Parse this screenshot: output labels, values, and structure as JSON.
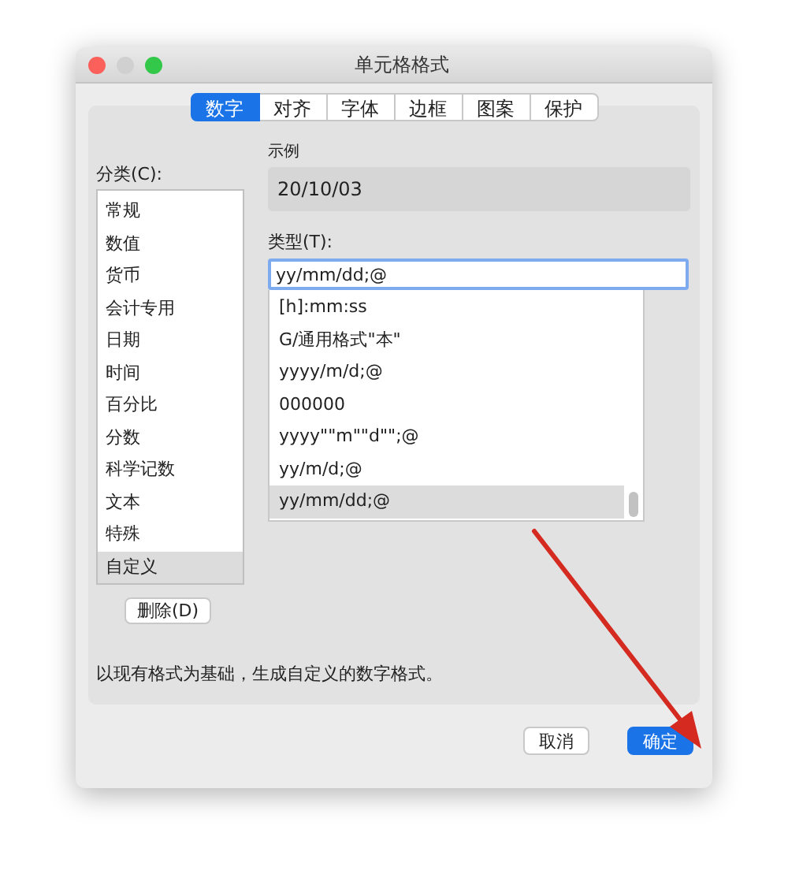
{
  "window": {
    "title": "单元格格式"
  },
  "tabs": [
    {
      "label": "数字",
      "selected": true
    },
    {
      "label": "对齐",
      "selected": false
    },
    {
      "label": "字体",
      "selected": false
    },
    {
      "label": "边框",
      "selected": false
    },
    {
      "label": "图案",
      "selected": false
    },
    {
      "label": "保护",
      "selected": false
    }
  ],
  "category": {
    "label": "分类(C):",
    "items": [
      {
        "label": "常规",
        "selected": false
      },
      {
        "label": "数值",
        "selected": false
      },
      {
        "label": "货币",
        "selected": false
      },
      {
        "label": "会计专用",
        "selected": false
      },
      {
        "label": "日期",
        "selected": false
      },
      {
        "label": "时间",
        "selected": false
      },
      {
        "label": "百分比",
        "selected": false
      },
      {
        "label": "分数",
        "selected": false
      },
      {
        "label": "科学记数",
        "selected": false
      },
      {
        "label": "文本",
        "selected": false
      },
      {
        "label": "特殊",
        "selected": false
      },
      {
        "label": "自定义",
        "selected": true
      }
    ],
    "delete_button": "删除(D)"
  },
  "sample": {
    "label": "示例",
    "value": "20/10/03"
  },
  "type": {
    "label": "类型(T):",
    "value": "yy/mm/dd;@",
    "items": [
      {
        "label": "[h]:mm:ss",
        "selected": false
      },
      {
        "label": "G/通用格式\"本\"",
        "selected": false
      },
      {
        "label": "yyyy/m/d;@",
        "selected": false
      },
      {
        "label": "000000",
        "selected": false
      },
      {
        "label": "yyyy\"\"m\"\"d\"\";@",
        "selected": false
      },
      {
        "label": "yy/m/d;@",
        "selected": false
      },
      {
        "label": "yy/mm/dd;@",
        "selected": true
      }
    ]
  },
  "description": "以现有格式为基础，生成自定义的数字格式。",
  "buttons": [
    {
      "label": "取消",
      "kind": "secondary"
    },
    {
      "label": "确定",
      "kind": "primary"
    }
  ]
}
